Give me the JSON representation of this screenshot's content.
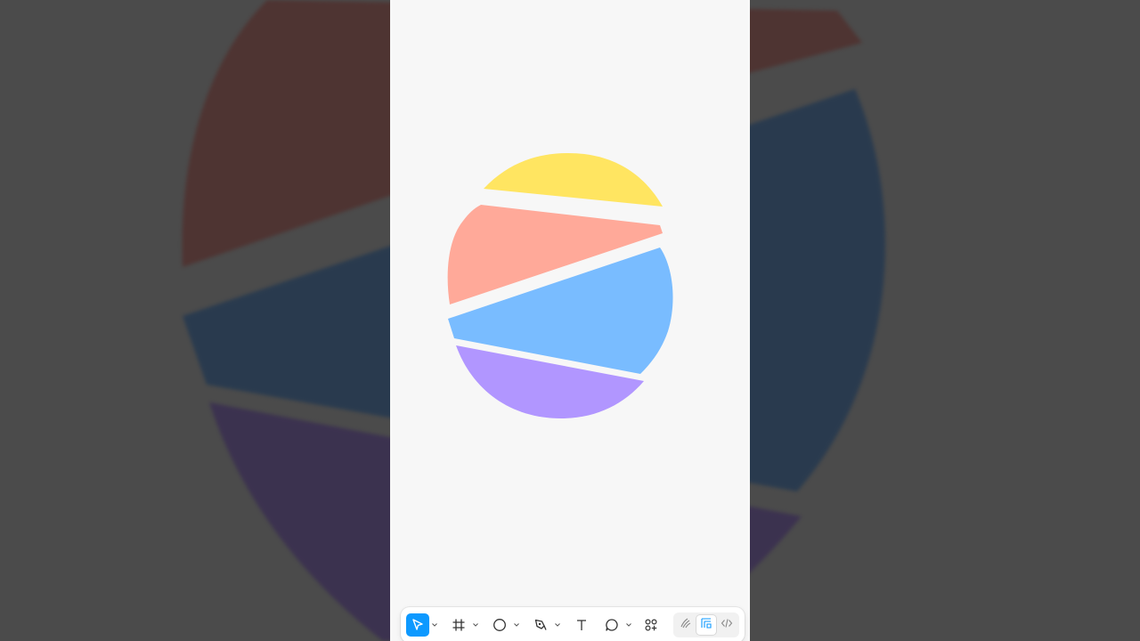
{
  "colors": {
    "background_dim": "#4b4b4b",
    "canvas": "#f7f7f7",
    "yellow": "#ffe561",
    "salmon": "#ffa999",
    "blue": "#79bcff",
    "purple": "#b196ff",
    "accent": "#0d99ff"
  },
  "toolbar": {
    "tools": [
      {
        "id": "move",
        "icon": "cursor-icon",
        "active": true,
        "has_menu": true
      },
      {
        "id": "frame",
        "icon": "frame-icon",
        "active": false,
        "has_menu": true
      },
      {
        "id": "shape",
        "icon": "ellipse-icon",
        "active": false,
        "has_menu": true
      },
      {
        "id": "pen",
        "icon": "pen-icon",
        "active": false,
        "has_menu": true
      },
      {
        "id": "text",
        "icon": "text-icon",
        "active": false,
        "has_menu": false
      },
      {
        "id": "comment",
        "icon": "comment-icon",
        "active": false,
        "has_menu": true
      },
      {
        "id": "resources",
        "icon": "resources-icon",
        "active": false,
        "has_menu": false
      }
    ],
    "modes": [
      {
        "id": "draw",
        "icon": "draw-mode-icon",
        "active": false
      },
      {
        "id": "design",
        "icon": "design-mode-icon",
        "active": true
      },
      {
        "id": "dev",
        "icon": "dev-mode-icon",
        "active": false
      }
    ]
  }
}
